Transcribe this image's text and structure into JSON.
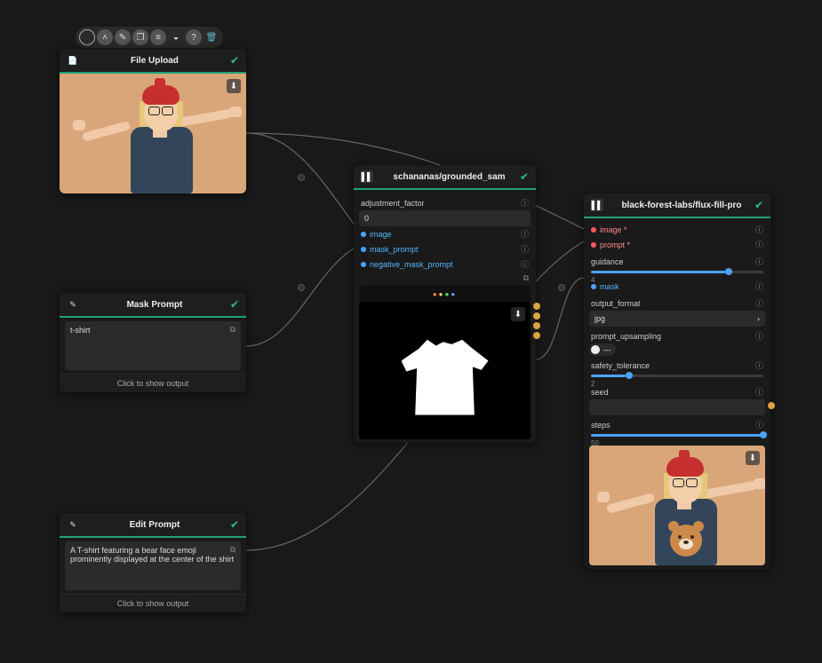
{
  "toolbar_icons": [
    "circle",
    "chevron-up",
    "pencil",
    "copy",
    "list",
    "eraser",
    "help",
    "trash"
  ],
  "file_upload": {
    "title": "File Upload"
  },
  "mask_prompt": {
    "title": "Mask Prompt",
    "text": "t-shirt",
    "footer": "Click to show output"
  },
  "edit_prompt": {
    "title": "Edit Prompt",
    "text": "A T-shirt featuring a bear face emoji prominently displayed at the center of the shirt",
    "footer": "Click to show output"
  },
  "sam": {
    "title": "schananas/grounded_sam",
    "adjustment_factor_label": "adjustment_factor",
    "adjustment_factor_value": "0",
    "ports": {
      "image": "image",
      "mask_prompt": "mask_prompt",
      "negative_mask_prompt": "negative_mask_prompt"
    }
  },
  "flux": {
    "title": "black-forest-labs/flux-fill-pro",
    "ports": {
      "image": "image *",
      "prompt": "prompt *",
      "mask": "mask"
    },
    "guidance_label": "guidance",
    "guidance_min": "4",
    "guidance_pct": 78,
    "output_format_label": "output_format",
    "output_format_value": "jpg",
    "prompt_upsampling_label": "prompt_upsampling",
    "prompt_upsampling_value": "---",
    "safety_tolerance_label": "safety_tolerance",
    "safety_tolerance_min": "2",
    "safety_tolerance_pct": 20,
    "seed_label": "seed",
    "seed_value": "",
    "steps_label": "steps",
    "steps_min": "50",
    "steps_pct": 100
  }
}
